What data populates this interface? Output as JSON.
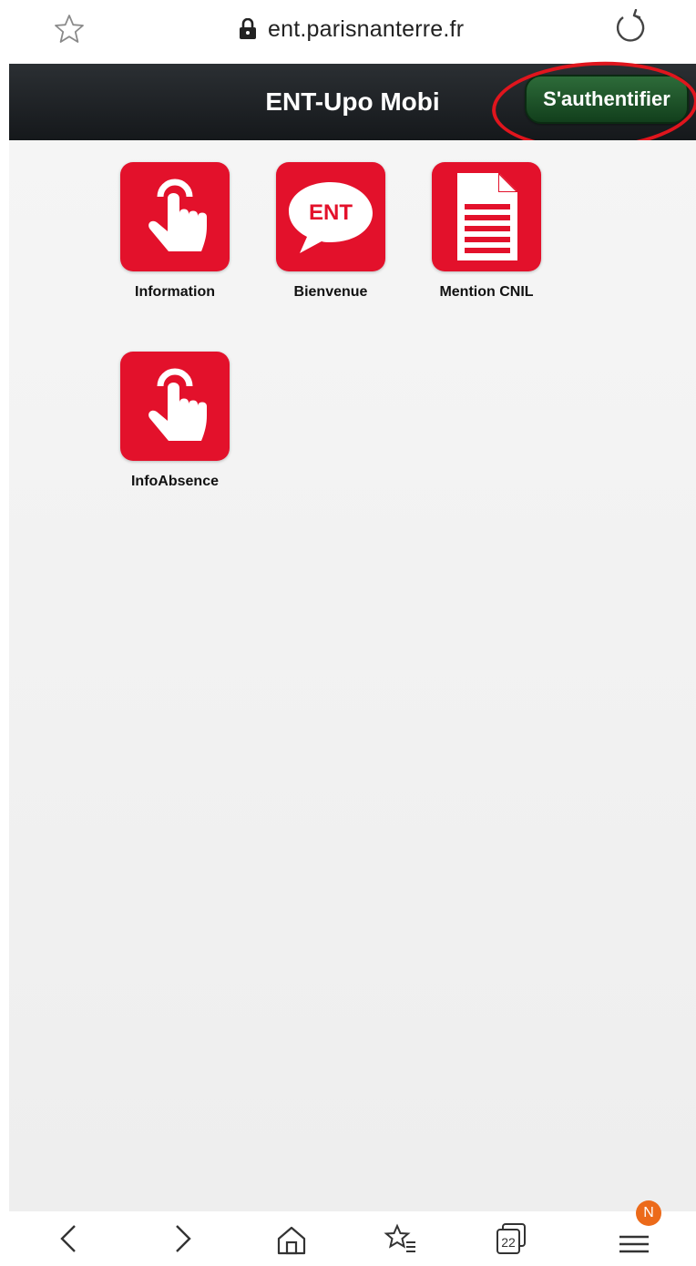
{
  "browser": {
    "url": "ent.parisnanterre.fr",
    "tab_count": "22",
    "menu_badge": "N"
  },
  "header": {
    "title": "ENT-Upo Mobi",
    "auth_button": "S'authentifier"
  },
  "icon_badge_text": "ENT",
  "tiles": [
    {
      "label": "Information",
      "icon": "touch-hand-icon"
    },
    {
      "label": "Bienvenue",
      "icon": "ent-speech-bubble-icon"
    },
    {
      "label": "Mention CNIL",
      "icon": "document-icon"
    },
    {
      "label": "InfoAbsence",
      "icon": "touch-hand-icon"
    }
  ],
  "colors": {
    "tile_red": "#e3112b",
    "header_dark": "#1f2326",
    "auth_green": "#1d5229",
    "highlight_ellipse": "#e0151d",
    "menu_badge": "#ec6a1a"
  }
}
